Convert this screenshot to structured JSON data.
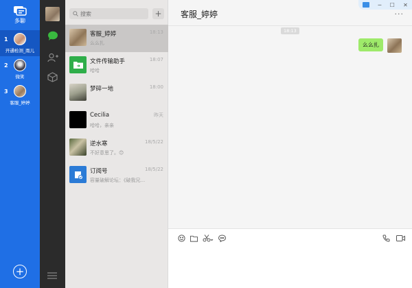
{
  "rail": {
    "brand_label": "多聊",
    "accounts": [
      {
        "num": "1",
        "name": "开通检测_雨儿",
        "active": true
      },
      {
        "num": "2",
        "name": "微笑",
        "active": false
      },
      {
        "num": "3",
        "name": "客服_婷婷",
        "active": false
      }
    ]
  },
  "search": {
    "placeholder": "搜索"
  },
  "conversations": [
    {
      "name": "客服_婷婷",
      "time": "18:13",
      "preview": "么么扎"
    },
    {
      "name": "文件传输助手",
      "time": "18:07",
      "preview": "哈哈"
    },
    {
      "name": "梦碎一地",
      "time": "18:00",
      "preview": ""
    },
    {
      "name": "Cecilia",
      "time": "昨天",
      "preview": "哈哈，亲亲"
    },
    {
      "name": "逆水寒",
      "time": "18/5/22",
      "preview": "不好意思了。😊"
    },
    {
      "name": "订阅号",
      "time": "18/5/22",
      "preview": "容量破解论坛：《破我兄..."
    }
  ],
  "chat": {
    "title": "客服_婷婷",
    "timestamp": "18:13",
    "message": "么么扎"
  },
  "colors": {
    "rail": "#1f6fe5",
    "nav": "#2b2b2b",
    "bubble": "#9eea6a"
  }
}
